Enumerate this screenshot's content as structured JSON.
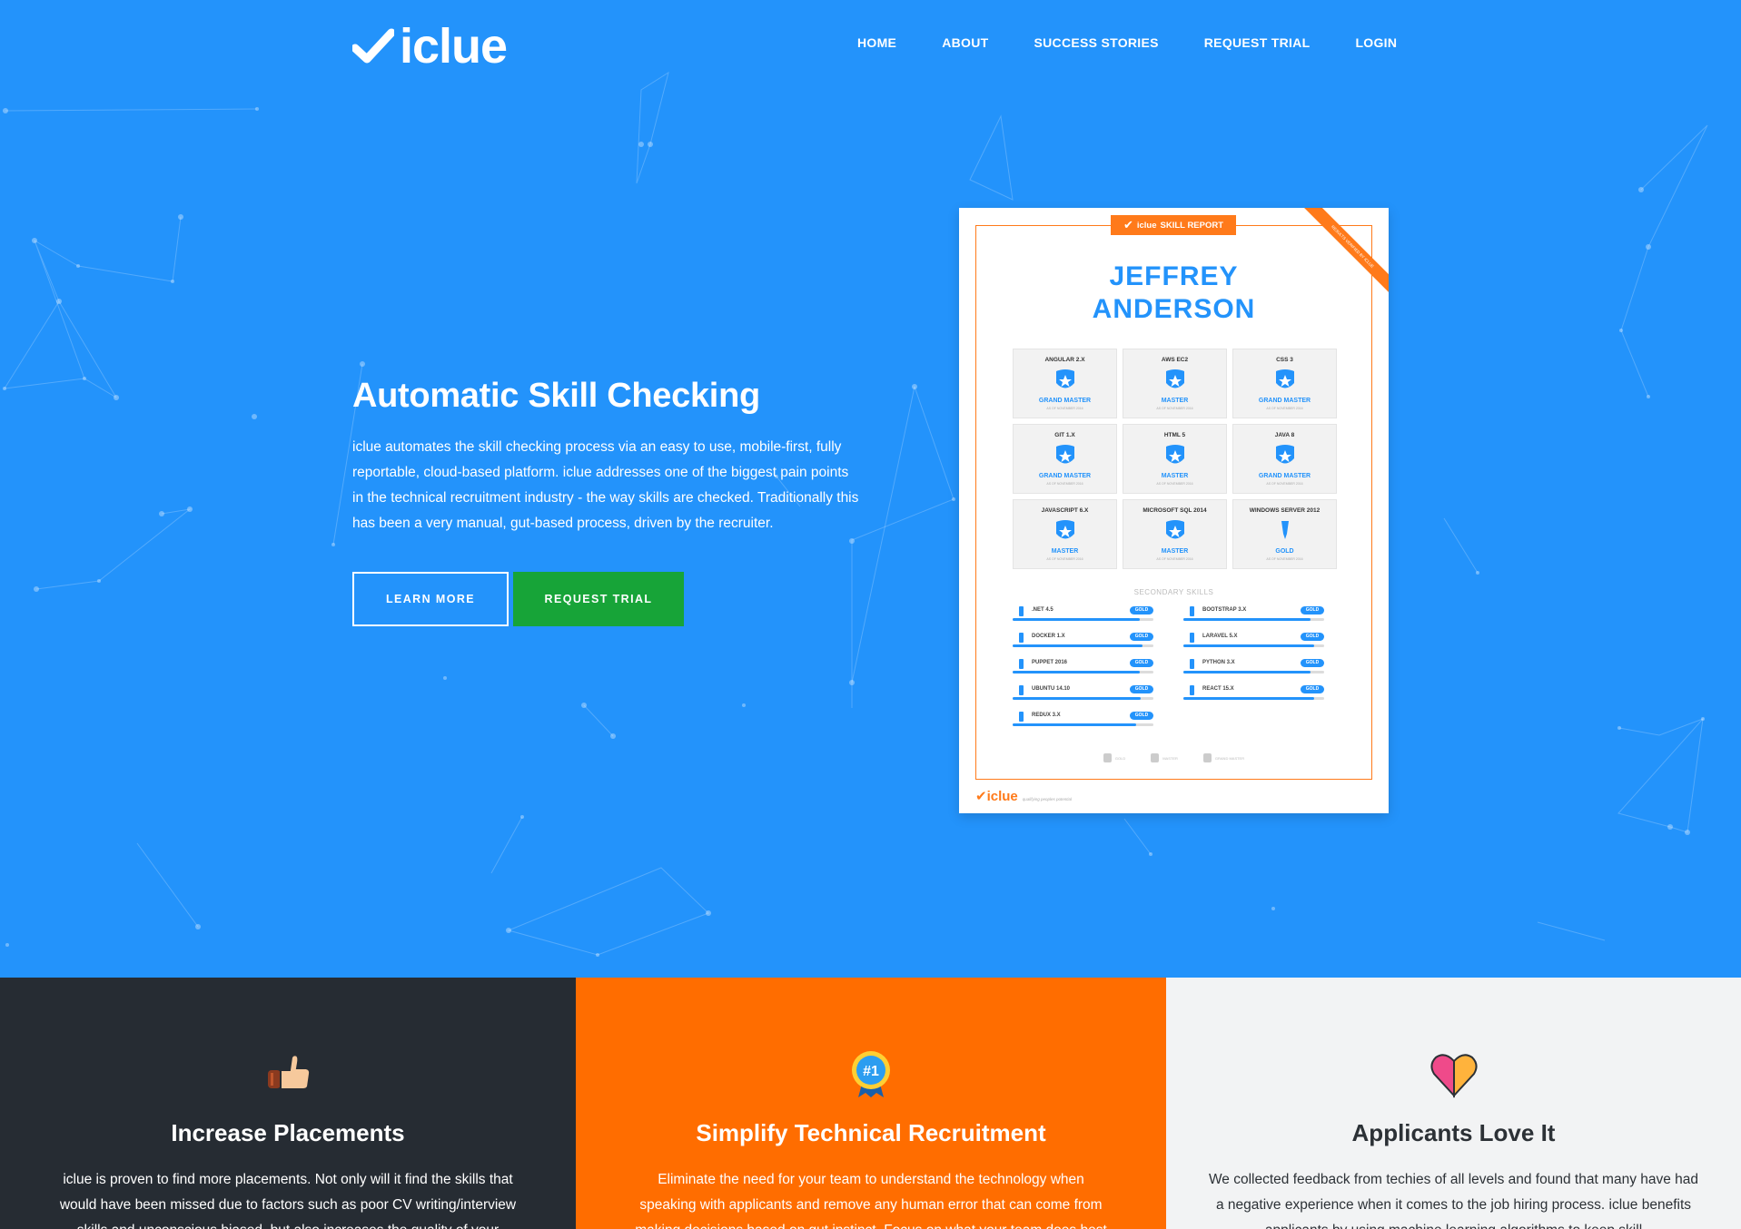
{
  "brand": {
    "name": "iclue",
    "logo_icon": "checkmark-icon"
  },
  "nav": {
    "items": [
      "HOME",
      "ABOUT",
      "SUCCESS STORIES",
      "REQUEST TRIAL",
      "LOGIN"
    ]
  },
  "hero": {
    "title": "Automatic Skill Checking",
    "body": "iclue automates the skill checking process via an easy to use, mobile-first, fully reportable, cloud-based platform. iclue addresses one of the biggest pain points in the technical recruitment industry - the way skills are checked. Traditionally this has been a very manual, gut-based process, driven by the recruiter.",
    "learn_more": "LEARN MORE",
    "request_trial": "REQUEST TRIAL"
  },
  "report": {
    "tag_brand": "iclue",
    "tag_label": "SKILL REPORT",
    "ribbon_text": "RESULTS VERIFIED BY ICLUE",
    "name_first": "JEFFREY",
    "name_last": "ANDERSON",
    "skills": [
      {
        "name": "ANGULAR 2.X",
        "level": "GRAND MASTER",
        "date": "AS OF NOVEMBER 2016"
      },
      {
        "name": "AWS EC2",
        "level": "MASTER",
        "date": "AS OF NOVEMBER 2016"
      },
      {
        "name": "CSS 3",
        "level": "GRAND MASTER",
        "date": "AS OF NOVEMBER 2016"
      },
      {
        "name": "GIT 1.X",
        "level": "GRAND MASTER",
        "date": "AS OF NOVEMBER 2016"
      },
      {
        "name": "HTML 5",
        "level": "MASTER",
        "date": "AS OF NOVEMBER 2016"
      },
      {
        "name": "JAVA 8",
        "level": "GRAND MASTER",
        "date": "AS OF NOVEMBER 2016"
      },
      {
        "name": "JAVASCRIPT 6.X",
        "level": "MASTER",
        "date": "AS OF NOVEMBER 2016"
      },
      {
        "name": "MICROSOFT SQL 2014",
        "level": "MASTER",
        "date": "AS OF NOVEMBER 2016"
      },
      {
        "name": "WINDOWS SERVER 2012",
        "level": "GOLD",
        "date": "AS OF NOVEMBER 2016"
      }
    ],
    "secondary_title": "SECONDARY SKILLS",
    "secondary_left": [
      {
        "name": ".NET 4.5",
        "level": "GOLD",
        "fill": 0.9
      },
      {
        "name": "DOCKER 1.X",
        "level": "GOLD",
        "fill": 0.92
      },
      {
        "name": "PUPPET 2016",
        "level": "GOLD",
        "fill": 0.9
      },
      {
        "name": "UBUNTU 14.10",
        "level": "GOLD",
        "fill": 0.91
      },
      {
        "name": "REDUX 3.X",
        "level": "GOLD",
        "fill": 0.88
      }
    ],
    "secondary_right": [
      {
        "name": "BOOTSTRAP 3.X",
        "level": "GOLD",
        "fill": 0.9
      },
      {
        "name": "LARAVEL 5.X",
        "level": "GOLD",
        "fill": 0.93
      },
      {
        "name": "PYTHON 3.X",
        "level": "GOLD",
        "fill": 0.9
      },
      {
        "name": "REACT 15.X",
        "level": "GOLD",
        "fill": 0.93
      }
    ],
    "legend": [
      "GOLD",
      "MASTER",
      "GRAND MASTER"
    ],
    "footer_brand": "iclue",
    "footer_tagline": "qualifying peoples potential"
  },
  "features": [
    {
      "icon": "thumbs-up-icon",
      "title": "Increase Placements",
      "body": "iclue is proven to find more placements. Not only will it find the skills that would have been missed due to factors such as poor CV writing/interview skills and unconscious biased, but also increases the quality of your"
    },
    {
      "icon": "award-ribbon-icon",
      "icon_text": "#1",
      "title": "Simplify Technical Recruitment",
      "body": "Eliminate the need for your team to understand the technology when speaking with applicants and remove any human error that can come from making decisions based on gut instinct. Focus on what your team does best"
    },
    {
      "icon": "heart-icon",
      "title": "Applicants Love It",
      "body": "We collected feedback from techies of all levels and found that many have had a negative experience when it comes to the job hiring process. iclue benefits applicants by using machine learning algorithms to keep skill"
    }
  ],
  "colors": {
    "hero_bg": "#2393fb",
    "green": "#17a438",
    "orange": "#ff6d00",
    "dark": "#262c33",
    "light": "#f2f3f4",
    "report_accent": "#ff7a1a"
  }
}
